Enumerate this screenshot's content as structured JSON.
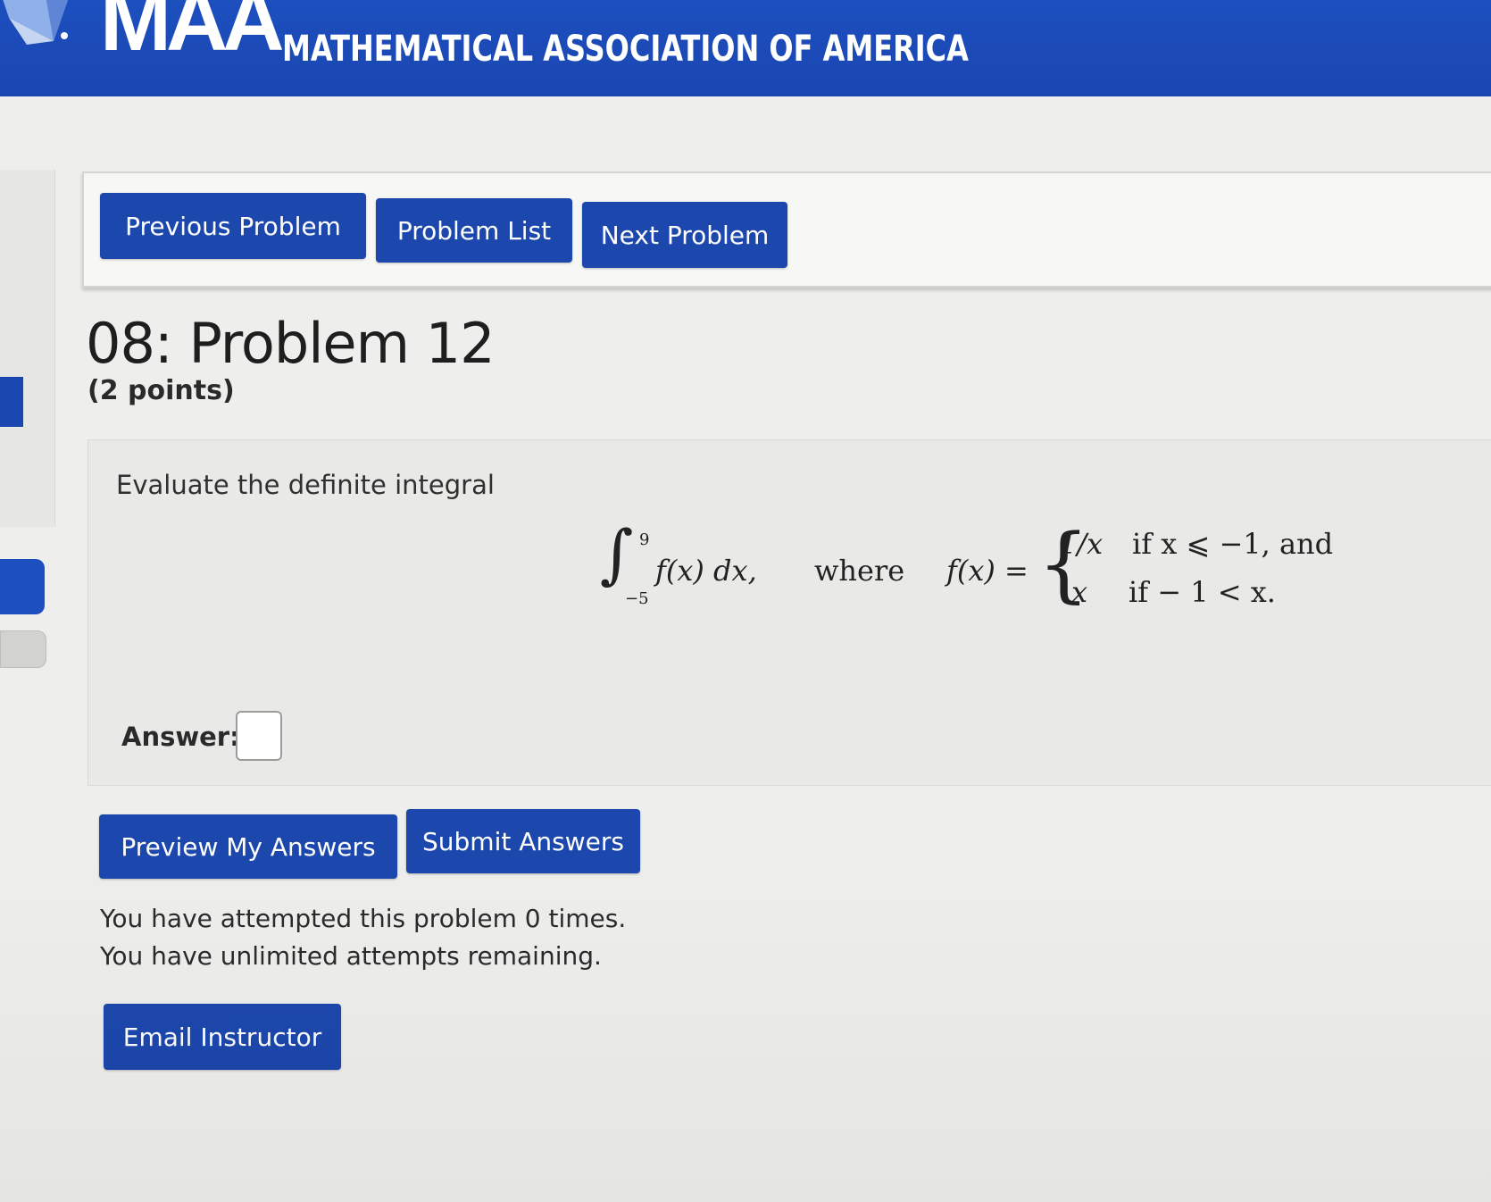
{
  "banner": {
    "logo_text": "MAA",
    "org_name": "MATHEMATICAL ASSOCIATION OF AMERICA",
    "color": "#1d4fbf"
  },
  "nav": {
    "previous_label": "Previous Problem",
    "list_label": "Problem List",
    "next_label": "Next Problem"
  },
  "problem": {
    "title": "08: Problem 12",
    "points": "(2 points)",
    "prompt": "Evaluate the definite integral",
    "integral": {
      "upper": "9",
      "lower": "−5",
      "integrand": "f(x) dx,",
      "where": "where",
      "fdef": "f(x) =",
      "case1_expr": "1/x",
      "case1_cond": "if x ⩽ −1, and",
      "case2_expr": "x",
      "case2_cond": "if − 1 < x."
    },
    "answer_label": "Answer:",
    "answer_value": ""
  },
  "actions": {
    "preview_label": "Preview My Answers",
    "submit_label": "Submit Answers",
    "email_label": "Email Instructor"
  },
  "attempts": {
    "line1": "You have attempted this problem 0 times.",
    "line2": "You have unlimited attempts remaining."
  },
  "colors": {
    "button": "#1c47ad",
    "page_bg": "#eeeeec",
    "problem_bg": "#e9e9e7"
  }
}
